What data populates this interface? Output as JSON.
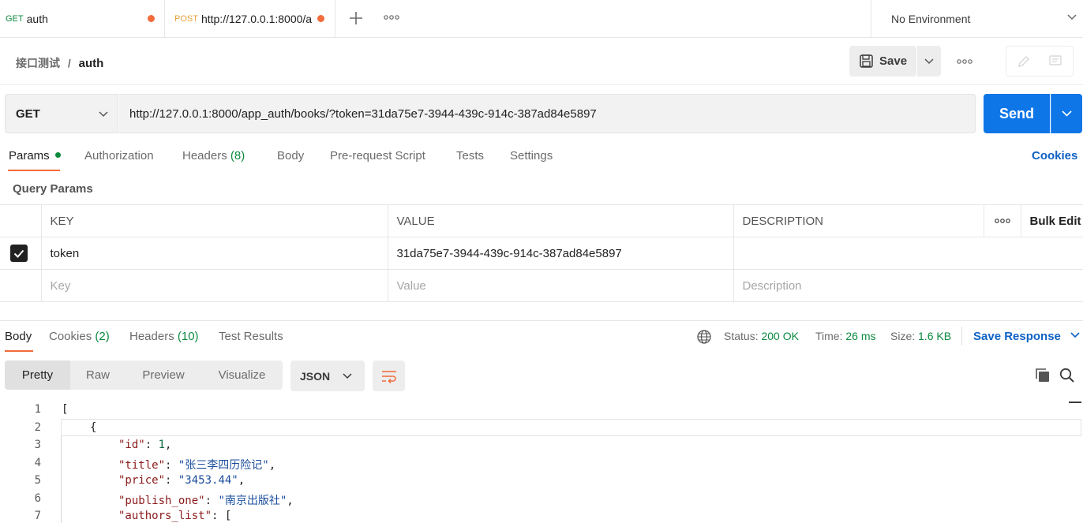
{
  "tabs": [
    {
      "method": "GET",
      "label": "auth"
    },
    {
      "method": "POST",
      "label": "http://127.0.0.1:8000/a"
    }
  ],
  "environment": "No Environment",
  "breadcrumb": {
    "collection": "接口测试",
    "separator": "/",
    "request": "auth"
  },
  "toolbar": {
    "save_label": "Save"
  },
  "request": {
    "method": "GET",
    "url": "http://127.0.0.1:8000/app_auth/books/?token=31da75e7-3944-439c-914c-387ad84e5897",
    "send_label": "Send"
  },
  "request_tabs": {
    "params": "Params",
    "authorization": "Authorization",
    "headers": "Headers",
    "headers_count": "(8)",
    "body": "Body",
    "prerequest": "Pre-request Script",
    "tests": "Tests",
    "settings": "Settings",
    "cookies": "Cookies"
  },
  "query_params": {
    "title": "Query Params",
    "columns": {
      "key": "KEY",
      "value": "VALUE",
      "description": "DESCRIPTION",
      "bulk_edit": "Bulk Edit"
    },
    "rows": [
      {
        "key": "token",
        "value": "31da75e7-3944-439c-914c-387ad84e5897",
        "description": ""
      }
    ],
    "placeholders": {
      "key": "Key",
      "value": "Value",
      "description": "Description"
    }
  },
  "response": {
    "tabs": {
      "body": "Body",
      "cookies": "Cookies",
      "cookies_count": "(2)",
      "headers": "Headers",
      "headers_count": "(10)",
      "test_results": "Test Results"
    },
    "status_label": "Status:",
    "status_value": "200 OK",
    "time_label": "Time:",
    "time_value": "26 ms",
    "size_label": "Size:",
    "size_value": "1.6 KB",
    "save_response": "Save Response",
    "view_modes": [
      "Pretty",
      "Raw",
      "Preview",
      "Visualize"
    ],
    "format": "JSON",
    "lines": [
      {
        "num": "1",
        "indent": 0,
        "text": "["
      },
      {
        "num": "2",
        "indent": 1,
        "text": "{"
      },
      {
        "num": "3",
        "indent": 2,
        "key": "\"id\"",
        "value": "1",
        "vtype": "n",
        "tail": ","
      },
      {
        "num": "4",
        "indent": 2,
        "key": "\"title\"",
        "value": "\"张三李四历险记\"",
        "vtype": "s",
        "tail": ","
      },
      {
        "num": "5",
        "indent": 2,
        "key": "\"price\"",
        "value": "\"3453.44\"",
        "vtype": "s",
        "tail": ","
      },
      {
        "num": "6",
        "indent": 2,
        "key": "\"publish_one\"",
        "value": "\"南京出版社\"",
        "vtype": "s",
        "tail": ","
      },
      {
        "num": "7",
        "indent": 2,
        "key": "\"authors_list\"",
        "value": "[",
        "vtype": "p",
        "tail": ""
      }
    ]
  }
}
